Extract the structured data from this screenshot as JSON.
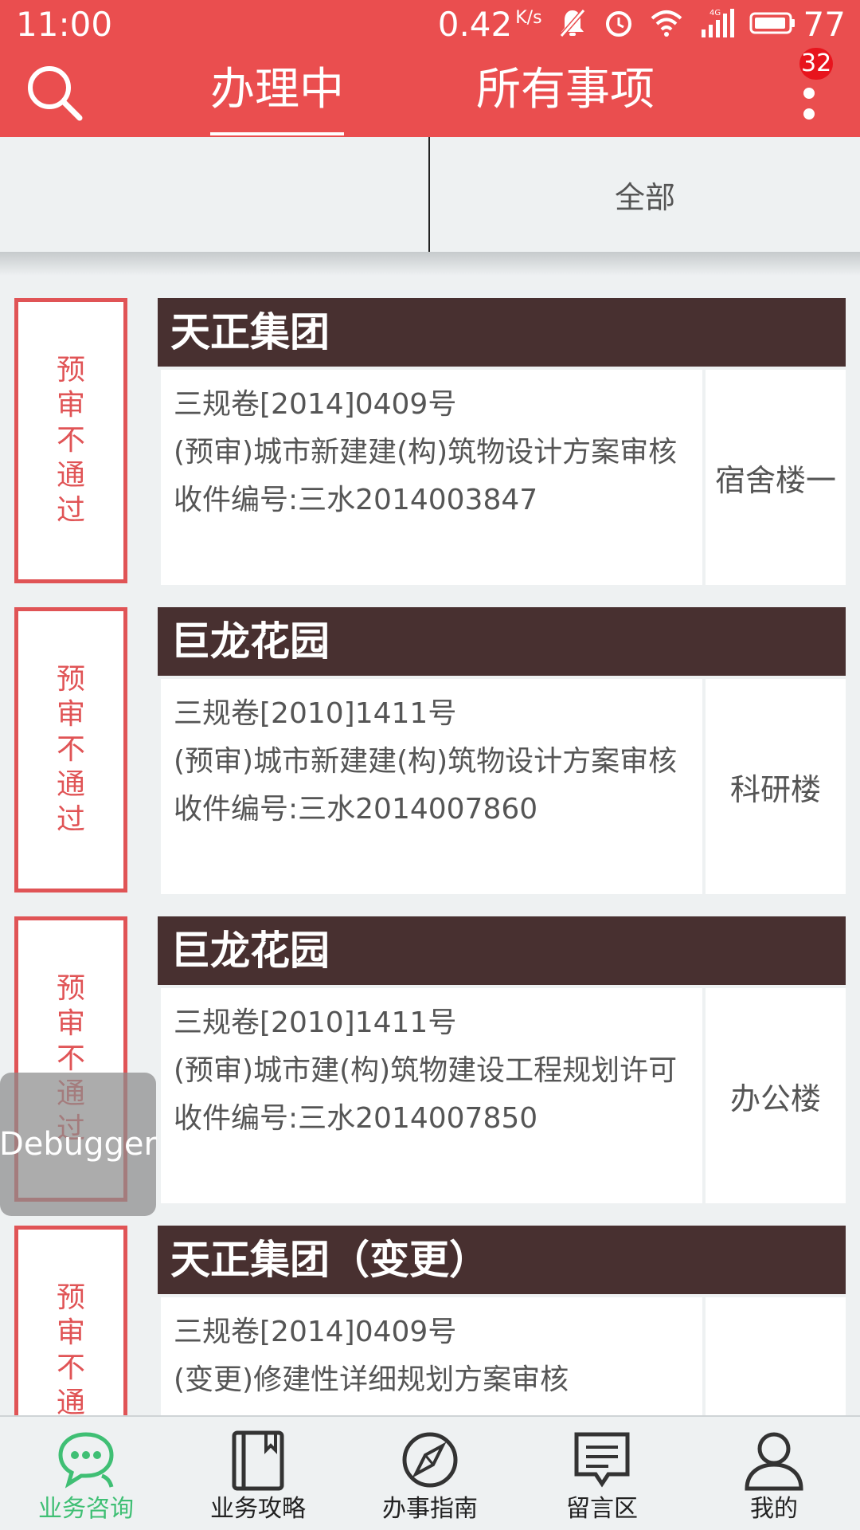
{
  "status_bar": {
    "time": "11:00",
    "net_speed": "0.42",
    "net_unit": "K/s",
    "network_type": "4G",
    "battery": "77"
  },
  "nav": {
    "tabs": [
      {
        "label": "办理中",
        "active": true
      },
      {
        "label": "所有事项",
        "active": false
      }
    ],
    "badge_count": "32"
  },
  "filter": {
    "left_label": "",
    "right_label": "全部"
  },
  "cards": [
    {
      "status": "预审不通过",
      "title": "天正集团",
      "lines": [
        "三规卷[2014]0409号",
        "(预审)城市新建建(构)筑物设计方案审核",
        "收件编号:三水2014003847"
      ],
      "side": "宿舍楼一"
    },
    {
      "status": "预审不通过",
      "title": "巨龙花园",
      "lines": [
        "三规卷[2010]1411号",
        "(预审)城市新建建(构)筑物设计方案审核",
        "收件编号:三水2014007860"
      ],
      "side": "科研楼"
    },
    {
      "status": "预审不通过",
      "title": "巨龙花园",
      "lines": [
        "三规卷[2010]1411号",
        "(预审)城市建(构)筑物建设工程规划许可",
        "收件编号:三水2014007850"
      ],
      "side": "办公楼"
    },
    {
      "status": "预审不通过",
      "title": "天正集团（变更）",
      "lines": [
        "三规卷[2014]0409号",
        "(变更)修建性详细规划方案审核",
        ""
      ],
      "side": ""
    }
  ],
  "debugger_label": "Debugger",
  "bottom_nav": {
    "active_color": "#3fbf74",
    "items": [
      {
        "label": "业务咨询",
        "icon": "chat-bubbles-icon",
        "active": true
      },
      {
        "label": "业务攻略",
        "icon": "book-icon",
        "active": false
      },
      {
        "label": "办事指南",
        "icon": "compass-icon",
        "active": false
      },
      {
        "label": "留言区",
        "icon": "message-board-icon",
        "active": false
      },
      {
        "label": "我的",
        "icon": "user-icon",
        "active": false
      }
    ]
  },
  "colors": {
    "header_red": "#ea4e4f",
    "title_bar_brown": "#483030",
    "stamp_red": "#e05456"
  }
}
